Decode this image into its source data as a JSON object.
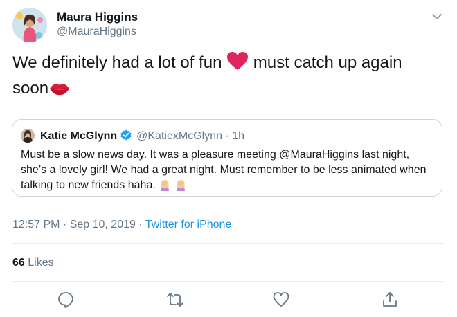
{
  "author": {
    "name": "Maura Higgins",
    "handle": "@MauraHiggins"
  },
  "tweet": {
    "text_part1": "We definitely had a lot of fun ",
    "text_part2": " must catch up again soon",
    "emojis": [
      "red-heart",
      "kiss-mark"
    ]
  },
  "quoted_tweet": {
    "name": "Katie McGlynn",
    "handle": "@KatiexMcGlynn",
    "time": "1h",
    "text": "Must be a slow news day. It was a pleasure meeting @MauraHiggins last night, she’s a lovely girl! We had a great night. Must remember to be less animated when talking to new friends haha.",
    "emojis": [
      "woman-facepalming",
      "woman-facepalming"
    ]
  },
  "meta": {
    "time": "12:57 PM",
    "date": "Sep 10, 2019",
    "source": "Twitter for iPhone"
  },
  "stats": {
    "likes_count": "66",
    "likes_label": "Likes"
  },
  "actions": [
    "reply-icon",
    "retweet-icon",
    "like-icon",
    "share-icon"
  ],
  "colors": {
    "text": "#14171a",
    "secondary": "#657786",
    "link": "#1b95e0",
    "border": "#ccd6dd",
    "heart": "#e0245e"
  }
}
